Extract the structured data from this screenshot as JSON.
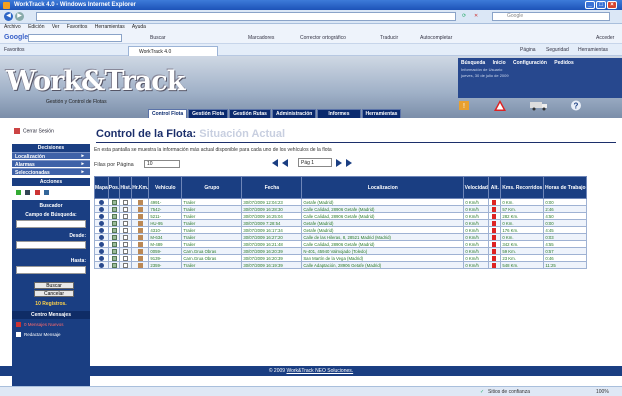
{
  "window": {
    "title": "WorkTrack 4.0 - Windows Internet Explorer"
  },
  "browser": {
    "websearch_placeholder": "Google",
    "menu": [
      "Archivo",
      "Edición",
      "Ver",
      "Favoritos",
      "Herramientas",
      "Ayuda"
    ],
    "googlebar": {
      "logo": "Google",
      "items": [
        "Buscar",
        "Marcadores",
        "Corrector ortográfico",
        "Traducir",
        "Autocompletar"
      ],
      "right": "Acceder"
    },
    "favorites_label": "Favoritos",
    "tab_title": "WorkTrack 4.0",
    "command_items": [
      "Página",
      "Seguridad",
      "Herramientas"
    ],
    "status_zone": "Sitios de confianza",
    "zoom": "100%"
  },
  "app": {
    "logo_text": "Work&Track",
    "logo_sub": "Gestión y Control de Flotas",
    "user_links": [
      "Búsqueda",
      "Inicio",
      "Configuración",
      "Pedidos"
    ],
    "user_info": [
      "Información de Usuario",
      "jueves, 30 de julio de 2009"
    ],
    "tabs": [
      "Control Flota",
      "Gestión Flota",
      "Gestión Rutas",
      "Administración",
      "Informes",
      "Herramientas"
    ],
    "active_tab": "Control Flota"
  },
  "sidebar": {
    "logout": "Cerrar Sesión",
    "decisiones": "Decisiones",
    "items": [
      "Localización",
      "Alarmas",
      "Seleccionadas"
    ],
    "acciones": "Acciones",
    "buscador": "Buscador",
    "campo_busqueda": "Campo de Búsqueda:",
    "desde": "Desde:",
    "hasta": "Hasta:",
    "buscar_btn": "Buscar",
    "cancelar_btn": "Cancelar",
    "registros": "10 Registros.",
    "centro_mensajes": "Centro Mensajes",
    "mensajes_nuevos": "0 Mensajes Nuevos",
    "redactar": "Redactar Mensaje"
  },
  "main": {
    "title": "Control de la Flota:",
    "subtitle": "Situación Actual",
    "description": "En esta pantalla se muestra la información más actual disponible para cada uno de los vehículos de la flota",
    "filas_label": "Filas por Página",
    "filas_value": "10",
    "page_value": "Pág 1",
    "columns": [
      "Mapa",
      "Pos.",
      "Hist.",
      "Hr.Km.",
      "Vehículo",
      "Grupo",
      "Fecha",
      "Localizacion",
      "Velocidad",
      "Alt.",
      "Kms. Recorridos",
      "Horas de Trabajo"
    ],
    "rows": [
      [
        "4991-",
        "Trailer",
        "30/07/2009 12:04:23",
        "Getafe (Madrid)",
        "0 Km/h",
        "0 Km.",
        "0:00"
      ],
      [
        "7542-",
        "Trailer",
        "30/07/2009 16:28:30",
        "Calle Calidad, 28906 Getafe (Madrid)",
        "0 Km/h",
        "57 Km.",
        "2:46"
      ],
      [
        "5211-",
        "Trailer",
        "30/07/2009 16:25:04",
        "Calle Calidad, 28906 Getafe (Madrid)",
        "0 Km/h",
        "282 Km.",
        "4:50"
      ],
      [
        "HU-95",
        "Trailer",
        "30/07/2009 7:28:54",
        "Getafe (Madrid)",
        "0 Km/h",
        "0 Km.",
        "0:00"
      ],
      [
        "4310-",
        "Trailer",
        "30/07/2009 16:17:34",
        "Getafe (Madrid)",
        "0 Km/h",
        "176 Km.",
        "4:45"
      ],
      [
        "M-634",
        "Trailer",
        "30/07/2009 16:27:20",
        "Calle de las Hileras, 8, 28521 Madrid (Madrid)",
        "0 Km/h",
        "0 Km.",
        "0:03"
      ],
      [
        "M-489",
        "Trailer",
        "30/07/2009 16:21:48",
        "Calle Calidad, 28906 Getafe (Madrid)",
        "0 Km/h",
        "342 Km.",
        "4:55"
      ],
      [
        "0059-",
        "Carn.Grua Obras",
        "30/07/2009 16:20:39",
        "N-401, 45940 Valmojado (Toledo)",
        "0 Km/h",
        "59 Km.",
        "0:57"
      ],
      [
        "9139-",
        "Carn.Grua Obras",
        "30/07/2009 16:20:39",
        "San Martín de la Vega (Madrid)",
        "0 Km/h",
        "23 Km.",
        "0:46"
      ],
      [
        "2359-",
        "Trailer",
        "30/07/2009 16:19:39",
        "Calle Adaptación, 28906 Getafe (Madrid)",
        "0 Km/h",
        "548 Km.",
        "11:25"
      ]
    ]
  },
  "footer": {
    "text": "© 2009",
    "link": "Work&Track NEO Soluciones."
  },
  "colors": {
    "nav_dark": "#1a3e82",
    "row_text": "#2a7a2a",
    "flag": "#d22222"
  }
}
